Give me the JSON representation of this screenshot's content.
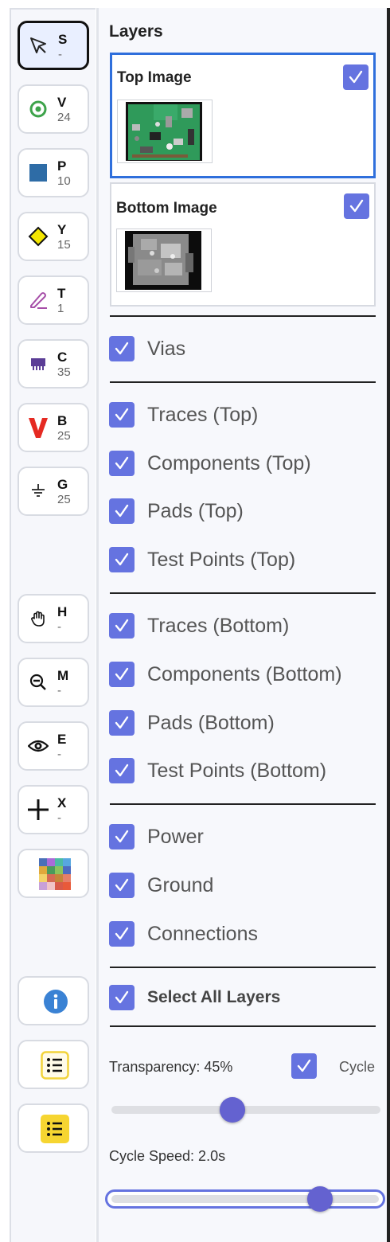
{
  "tools": [
    {
      "key": "S",
      "count": "-",
      "icon": "cursor-arrow-icon",
      "active": true
    },
    {
      "key": "V",
      "count": "24",
      "icon": "via-ring-icon",
      "color": "#3da34a"
    },
    {
      "key": "P",
      "count": "10",
      "icon": "pad-square-icon",
      "color": "#2e6ca6"
    },
    {
      "key": "Y",
      "count": "15",
      "icon": "test-point-diamond-icon",
      "color": "#f4e600"
    },
    {
      "key": "T",
      "count": "1",
      "icon": "trace-pen-icon",
      "color": "#a64ea8"
    },
    {
      "key": "C",
      "count": "35",
      "icon": "component-chip-icon",
      "color": "#5b3d96"
    },
    {
      "key": "B",
      "count": "25",
      "icon": "power-v-icon",
      "color": "#e52a22"
    },
    {
      "key": "G",
      "count": "25",
      "icon": "ground-symbol-icon"
    },
    {
      "key": "H",
      "count": "-",
      "icon": "hand-pan-icon"
    },
    {
      "key": "M",
      "count": "-",
      "icon": "zoom-out-icon"
    },
    {
      "key": "E",
      "count": "-",
      "icon": "eye-icon"
    },
    {
      "key": "X",
      "count": "-",
      "icon": "crosshair-plus-icon"
    },
    {
      "icon": "color-palette-icon"
    },
    {
      "icon": "info-icon",
      "color": "#3a82d4"
    },
    {
      "icon": "list-outline-icon",
      "color": "#f2d33b"
    },
    {
      "icon": "list-filled-icon",
      "color": "#f6d531"
    }
  ],
  "panel": {
    "title": "Layers",
    "images": [
      {
        "label": "Top Image",
        "checked": true,
        "selected": true
      },
      {
        "label": "Bottom Image",
        "checked": true,
        "selected": false
      }
    ],
    "groups": [
      [
        {
          "label": "Vias",
          "checked": true
        }
      ],
      [
        {
          "label": "Traces (Top)",
          "checked": true
        },
        {
          "label": "Components (Top)",
          "checked": true
        },
        {
          "label": "Pads (Top)",
          "checked": true
        },
        {
          "label": "Test Points (Top)",
          "checked": true
        }
      ],
      [
        {
          "label": "Traces (Bottom)",
          "checked": true
        },
        {
          "label": "Components (Bottom)",
          "checked": true
        },
        {
          "label": "Pads (Bottom)",
          "checked": true
        },
        {
          "label": "Test Points (Bottom)",
          "checked": true
        }
      ],
      [
        {
          "label": "Power",
          "checked": true
        },
        {
          "label": "Ground",
          "checked": true
        },
        {
          "label": "Connections",
          "checked": true
        }
      ]
    ],
    "select_all": {
      "label": "Select All Layers",
      "checked": true
    },
    "transparency": {
      "label": "Transparency: 45%",
      "value": 0.45
    },
    "cycle": {
      "label": "Cycle",
      "checked": true
    },
    "cycle_speed": {
      "label": "Cycle Speed: 2.0s",
      "value": 0.78
    }
  },
  "colors": {
    "accent": "#6573e0",
    "selected_border": "#2f6fdc",
    "slider_knob": "#6462d0"
  }
}
